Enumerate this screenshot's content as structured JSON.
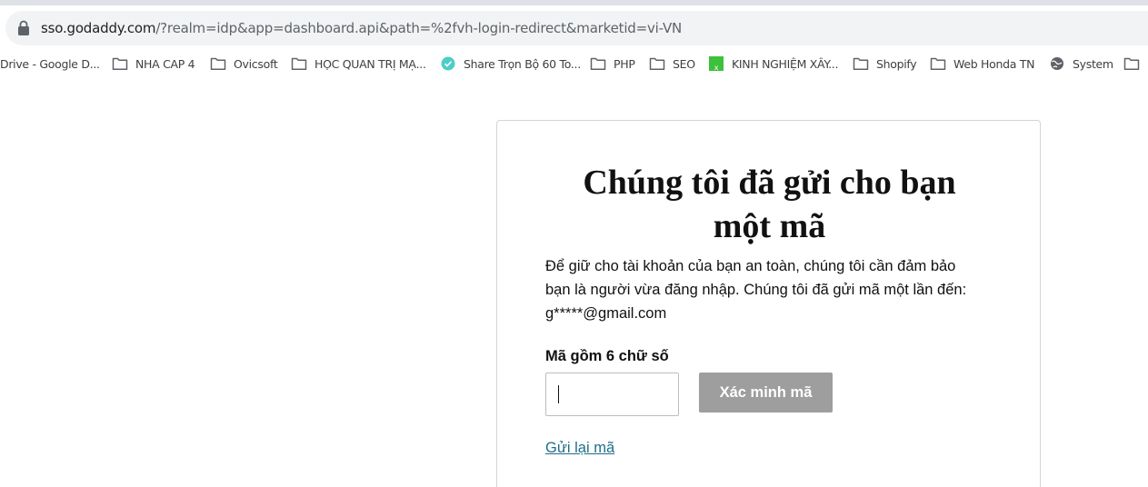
{
  "browser": {
    "url_host": "sso.godaddy.com",
    "url_rest": "/?realm=idp&app=dashboard.api&path=%2fvh-login-redirect&marketid=vi-VN",
    "bookmarks": [
      {
        "label": "Drive - Google D...",
        "icon": "drive-icon"
      },
      {
        "label": "NHA CAP 4",
        "icon": "folder-icon"
      },
      {
        "label": "Ovicsoft",
        "icon": "folder-icon"
      },
      {
        "label": "HỌC QUAN TRỊ MẠ...",
        "icon": "folder-icon"
      },
      {
        "label": "Share Trọn Bộ 60 To...",
        "icon": "check-circle-icon"
      },
      {
        "label": "PHP",
        "icon": "folder-icon"
      },
      {
        "label": "SEO",
        "icon": "folder-icon"
      },
      {
        "label": "KINH NGHIỆM XÂY...",
        "icon": "green-x-icon"
      },
      {
        "label": "Shopify",
        "icon": "folder-icon"
      },
      {
        "label": "Web Honda TN",
        "icon": "folder-icon"
      },
      {
        "label": "System",
        "icon": "globe-icon"
      },
      {
        "label": "",
        "icon": "folder-icon"
      }
    ]
  },
  "card": {
    "title": "Chúng tôi đã gửi cho bạn một mã",
    "description_line1": "Để giữ cho tài khoản của bạn an toàn, chúng tôi cần đảm bảo",
    "description_line2": "bạn là người vừa đăng nhập. Chúng tôi đã gửi mã một lần đến:",
    "masked_email": "g*****@gmail.com",
    "code_label": "Mã gồm 6 chữ số",
    "code_value": "",
    "verify_label": "Xác minh mã",
    "resend_label": "Gửi lại mã"
  },
  "colors": {
    "verify_button": "#9e9e9e",
    "link": "#1e6e8a",
    "check_icon": "#4ecdc4",
    "green_icon": "#3cc13b"
  }
}
